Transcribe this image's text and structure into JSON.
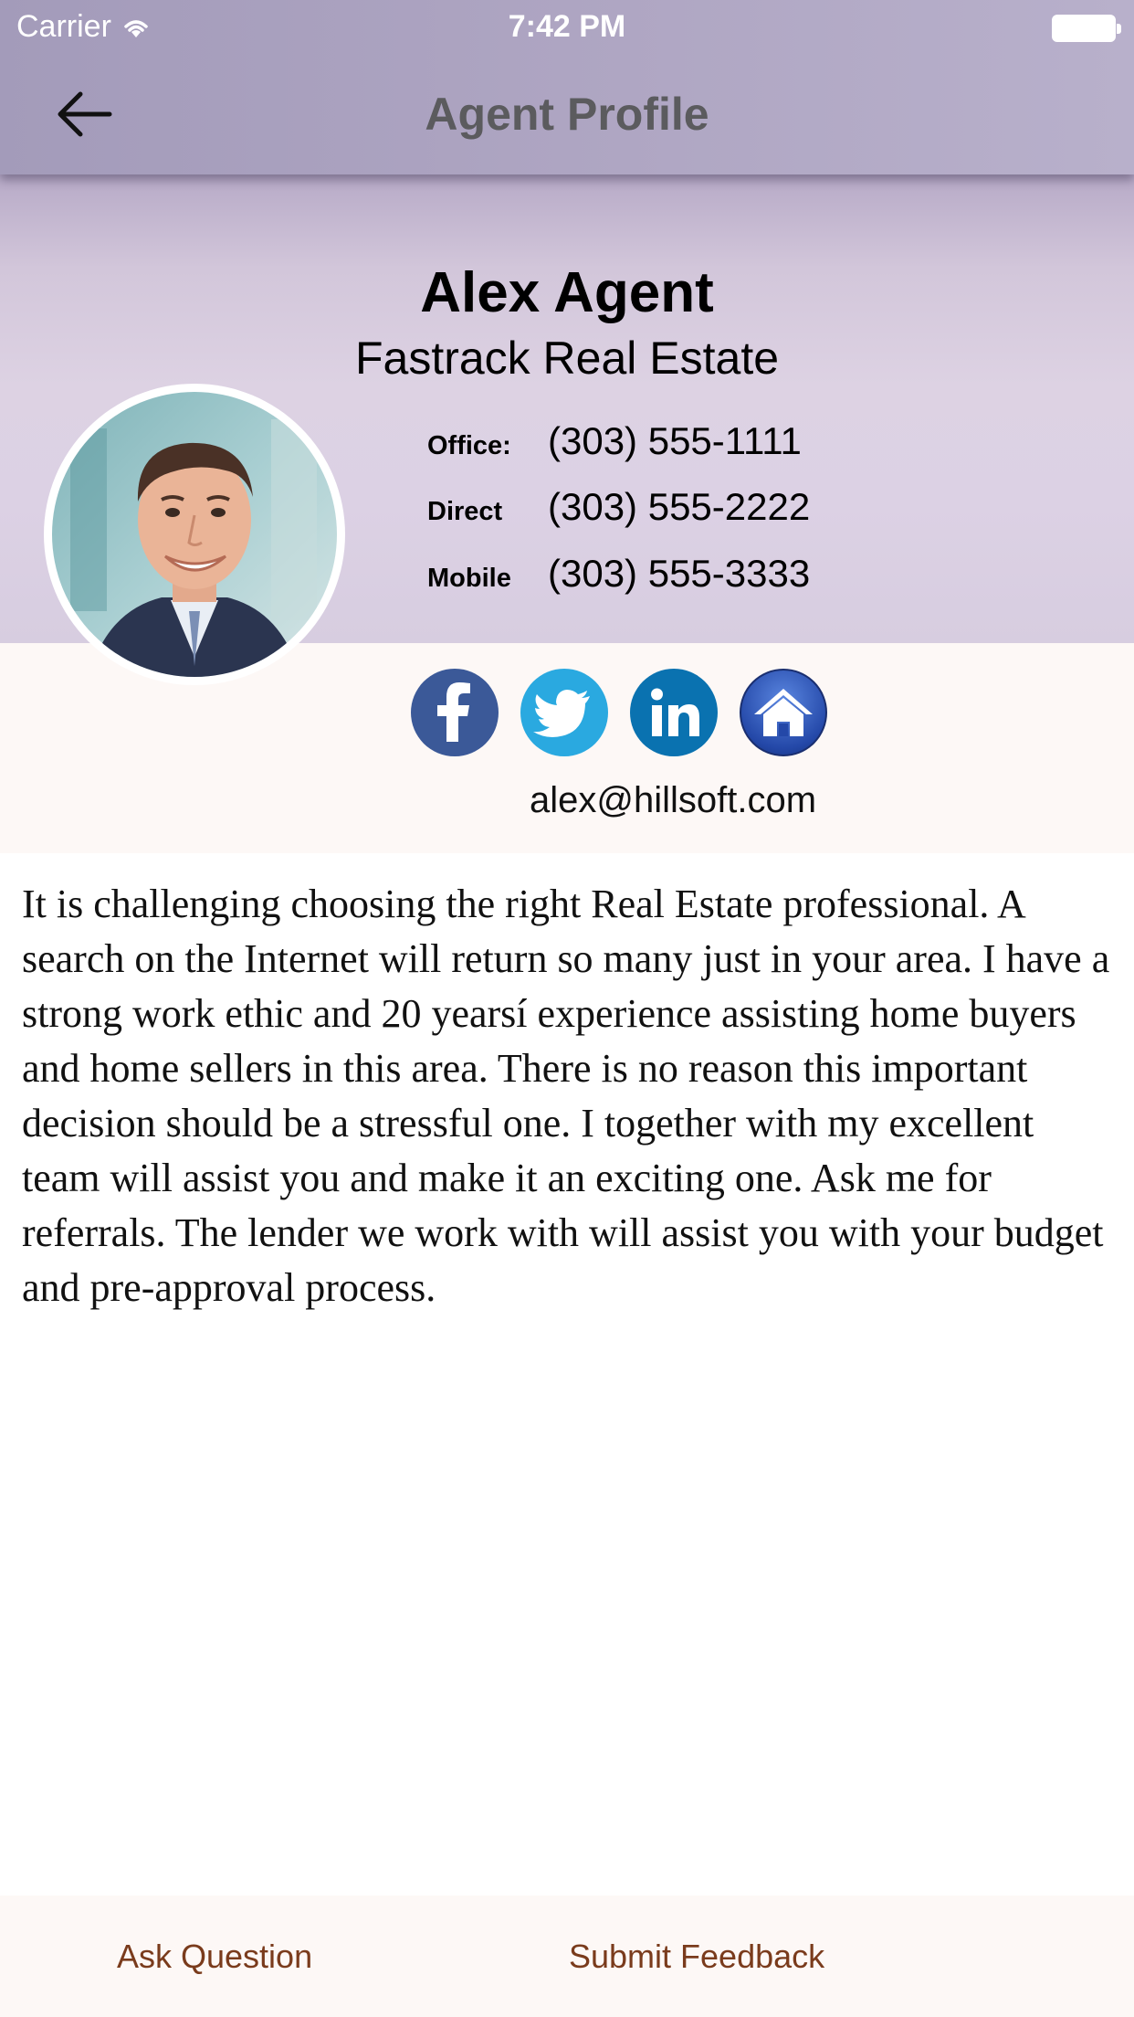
{
  "status_bar": {
    "carrier": "Carrier",
    "time": "7:42 PM"
  },
  "nav": {
    "title": "Agent Profile",
    "back_icon": "arrow-left-icon"
  },
  "agent": {
    "name": "Alex Agent",
    "company": "Fastrack Real Estate",
    "phones": [
      {
        "label": "Office:",
        "value": "(303) 555-1111"
      },
      {
        "label": "Direct",
        "value": "(303) 555-2222"
      },
      {
        "label": "Mobile",
        "value": "(303) 555-3333"
      }
    ],
    "email": "alex@hillsoft.com",
    "socials": [
      {
        "name": "facebook-icon",
        "color": "#3b5998"
      },
      {
        "name": "twitter-icon",
        "color": "#2aa9e0"
      },
      {
        "name": "linkedin-icon",
        "color": "#0a72b0"
      },
      {
        "name": "home-icon",
        "color": "#2448a8"
      }
    ],
    "bio": "It is challenging choosing the right Real Estate professional. A search on the Internet will return so many just in your area. I have a strong work ethic and 20 yearsí experience assisting home buyers and home sellers in this area. There is no reason this important decision should be a stressful one. I together with my excellent team will assist you and make it an exciting one. Ask me for referrals. The lender we work with will assist you with your budget and pre-approval process."
  },
  "bottom_bar": {
    "ask": "Ask Question",
    "feedback": "Submit Feedback"
  },
  "colors": {
    "nav": "#aea5c2",
    "accent_text": "#7a3b1c",
    "band": "#fdf8f6"
  }
}
